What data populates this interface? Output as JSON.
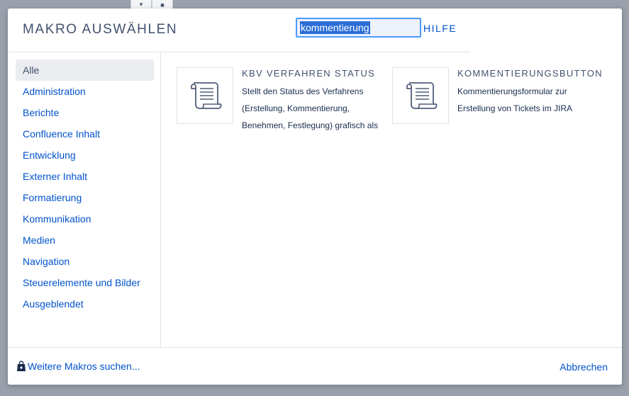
{
  "dialog": {
    "title": "MAKRO AUSWÄHLEN",
    "search": {
      "value": "kommentierung",
      "placeholder": ""
    },
    "help_label": "HILFE"
  },
  "sidebar": {
    "items": [
      {
        "label": "Alle",
        "selected": true
      },
      {
        "label": "Administration",
        "selected": false
      },
      {
        "label": "Berichte",
        "selected": false
      },
      {
        "label": "Confluence Inhalt",
        "selected": false
      },
      {
        "label": "Entwicklung",
        "selected": false
      },
      {
        "label": "Externer Inhalt",
        "selected": false
      },
      {
        "label": "Formatierung",
        "selected": false
      },
      {
        "label": "Kommunikation",
        "selected": false
      },
      {
        "label": "Medien",
        "selected": false
      },
      {
        "label": "Navigation",
        "selected": false
      },
      {
        "label": "Steuerelemente und Bilder",
        "selected": false
      },
      {
        "label": "Ausgeblendet",
        "selected": false
      }
    ]
  },
  "macros": [
    {
      "title": "KBV VERFAHREN STATUS",
      "description": "Stellt den Status des Verfahrens (Erstellung, Kommentierung, Benehmen, Festlegung) grafisch als",
      "icon": "scroll-icon"
    },
    {
      "title": "KOMMENTIERUNGSBUTTON",
      "description": "Kommentierungsformular zur Erstellung von Tickets im JIRA",
      "icon": "scroll-icon"
    }
  ],
  "footer": {
    "more_macros_label": "Weitere Makros suchen...",
    "more_macros_icon": "shopping-bag-icon",
    "cancel_label": "Abbrechen"
  },
  "colors": {
    "link": "#0052cc",
    "heading": "#42526e",
    "selected_bg": "#ebecf0",
    "overlay": "#9aa1ac",
    "search_border": "#4c9aff"
  }
}
